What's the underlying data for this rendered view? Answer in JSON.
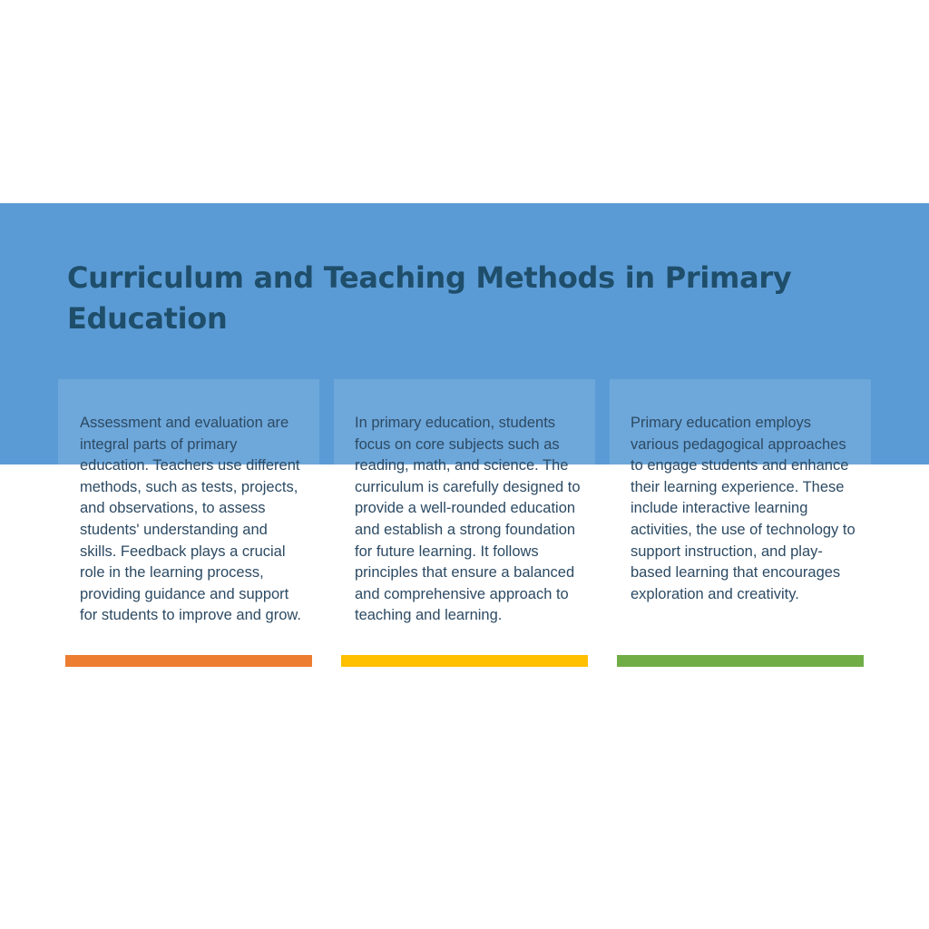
{
  "title": "Curriculum and Teaching Methods in Primary Education",
  "colors": {
    "banner": "#5b9bd5",
    "title": "#1f4e6b",
    "body_text": "#2c4a63",
    "accent_orange": "#ed7d31",
    "accent_yellow": "#ffc000",
    "accent_green": "#70ad47"
  },
  "cards": [
    {
      "text": "Assessment and evaluation are integral parts of primary education. Teachers use different methods, such as tests, projects, and observations, to assess students' understanding and skills. Feedback plays a crucial role in the learning process, providing guidance and support for students to improve and grow."
    },
    {
      "text": "In primary education, students focus on core subjects such as reading, math, and science. The curriculum is carefully designed to provide a well-rounded education and establish a strong foundation for future learning. It follows principles that ensure a balanced and comprehensive approach to teaching and learning."
    },
    {
      "text": "Primary education employs various pedagogical approaches to engage students and enhance their learning experience. These include interactive learning activities, the use of technology to support instruction, and play-based learning that encourages exploration and creativity."
    }
  ]
}
